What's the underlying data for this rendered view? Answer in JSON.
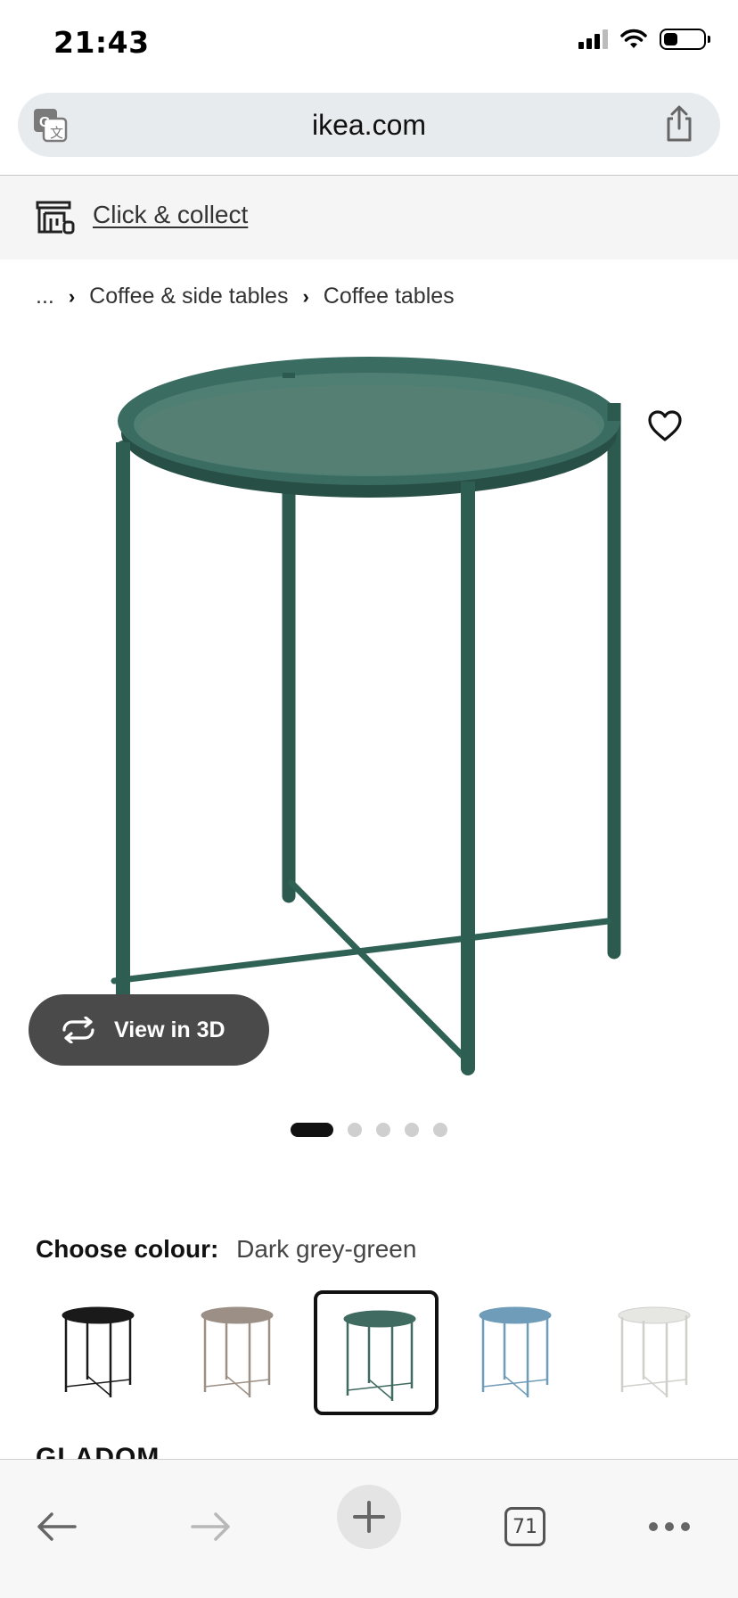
{
  "status_bar": {
    "time": "21:43",
    "icons": [
      "cellular-signal-icon",
      "wifi-icon",
      "battery-icon"
    ],
    "battery_level": 0.35
  },
  "browser": {
    "url": "ikea.com",
    "translate_icon": "translate-icon",
    "share_icon": "share-icon"
  },
  "collect": {
    "label": "Click & collect",
    "icon": "store-icon"
  },
  "breadcrumb": {
    "items": [
      "...",
      "Coffee & side tables",
      "Coffee tables"
    ]
  },
  "product": {
    "image": "tray-table-dark-grey-green",
    "color_hex": "#2f5d52",
    "favourite_icon": "heart-icon",
    "view3d_label": "View in 3D",
    "carousel_pages": 5,
    "carousel_active": 1,
    "name_peek": "GLADOM"
  },
  "colour": {
    "label": "Choose colour:",
    "selected": "Dark grey-green",
    "swatches": [
      {
        "color": "#1a1a1a",
        "selected": false
      },
      {
        "color": "#9b8f86",
        "selected": false
      },
      {
        "color": "#3f6b60",
        "selected": true
      },
      {
        "color": "#6f9cb8",
        "selected": false
      },
      {
        "color": "#e6e6e2",
        "selected": false
      }
    ]
  },
  "toolbar": {
    "tab_count": "71",
    "icons": [
      "back-arrow-icon",
      "forward-arrow-icon",
      "plus-icon",
      "tabs-icon",
      "more-icon"
    ]
  }
}
